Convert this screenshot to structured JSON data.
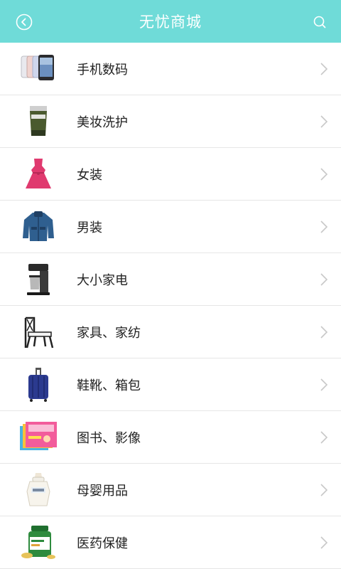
{
  "header": {
    "title": "无忧商城",
    "back_icon": "back-circle-icon",
    "search_icon": "search-icon"
  },
  "colors": {
    "header_bg": "#6fdbd8",
    "divider": "#e6e6e6",
    "text": "#222222",
    "chevron": "#c8c8c8"
  },
  "categories": [
    {
      "label": "手机数码",
      "icon": "phones-icon"
    },
    {
      "label": "美妆洗护",
      "icon": "cosmetics-tube-icon"
    },
    {
      "label": "女装",
      "icon": "dress-icon"
    },
    {
      "label": "男装",
      "icon": "jacket-icon"
    },
    {
      "label": "大小家电",
      "icon": "coffee-maker-icon"
    },
    {
      "label": "家具、家纺",
      "icon": "chair-icon"
    },
    {
      "label": "鞋靴、箱包",
      "icon": "suitcase-icon"
    },
    {
      "label": "图书、影像",
      "icon": "books-icon"
    },
    {
      "label": "母婴用品",
      "icon": "baby-bottle-icon"
    },
    {
      "label": "医药保健",
      "icon": "medicine-bottle-icon"
    }
  ]
}
